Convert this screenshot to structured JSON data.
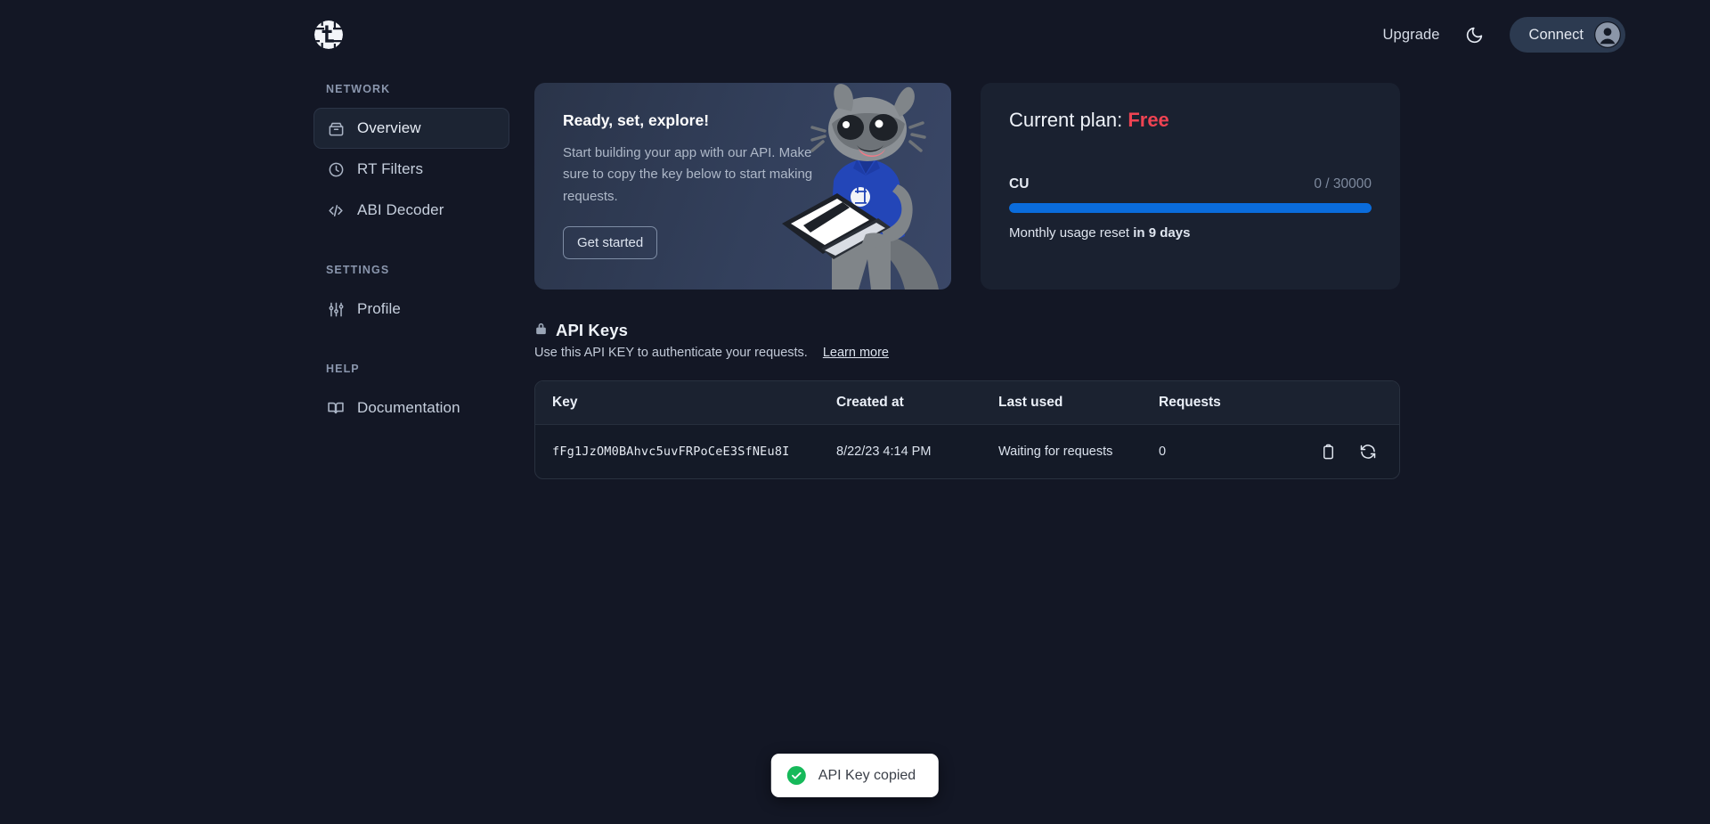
{
  "header": {
    "logo_icon": "circular-t-logo-icon",
    "upgrade_label": "Upgrade",
    "theme_toggle_icon": "moon-icon",
    "connect_label": "Connect",
    "avatar_icon": "user-avatar-icon"
  },
  "sidebar": {
    "sections": [
      {
        "title": "NETWORK",
        "items": [
          {
            "label": "Overview",
            "icon": "box-icon",
            "active": true
          },
          {
            "label": "RT Filters",
            "icon": "clock-icon",
            "active": false
          },
          {
            "label": "ABI Decoder",
            "icon": "code-brackets-icon",
            "active": false
          }
        ]
      },
      {
        "title": "SETTINGS",
        "items": [
          {
            "label": "Profile",
            "icon": "sliders-icon",
            "active": false
          }
        ]
      },
      {
        "title": "HELP",
        "items": [
          {
            "label": "Documentation",
            "icon": "open-book-icon",
            "active": false
          }
        ]
      }
    ]
  },
  "banner": {
    "heading": "Ready, set, explore!",
    "body": "Start building your app with our API. Make sure to copy the key below to start making requests.",
    "cta_label": "Get started",
    "mascot_icon": "raccoon-mascot-with-laptop-illustration"
  },
  "plan": {
    "title_prefix": "Current plan:",
    "plan_name": "Free",
    "plan_name_color": "#ef4352",
    "usage_label": "CU",
    "usage_value": "0 / 30000",
    "usage_used": 0,
    "usage_limit": 30000,
    "progress_percent": 100,
    "progress_color": "#0a6cdc",
    "reset_note_prefix": "Monthly usage reset ",
    "reset_note_strong": "in 9 days"
  },
  "api_keys": {
    "lock_icon": "lock-icon",
    "title": "API Keys",
    "subtitle": "Use this API KEY to authenticate your requests.",
    "learn_more_label": "Learn more",
    "columns": [
      "Key",
      "Created at",
      "Last used",
      "Requests",
      ""
    ],
    "rows": [
      {
        "key": "fFg1JzOM0BAhvc5uvFRPoCeE3SfNEu8I",
        "created_at": "8/22/23 4:14 PM",
        "last_used": "Waiting for requests",
        "requests": "0",
        "copy_icon": "clipboard-copy-icon",
        "regenerate_icon": "refresh-regenerate-icon"
      }
    ]
  },
  "toast": {
    "icon": "check-circle-icon",
    "message": "API Key copied"
  }
}
